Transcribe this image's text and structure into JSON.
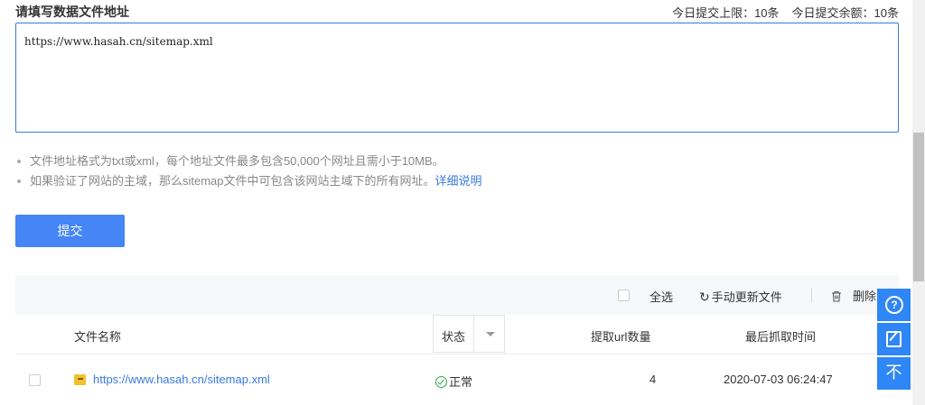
{
  "header": {
    "title": "请填写数据文件地址",
    "quota_limit": "今日提交上限：10条",
    "quota_remaining": "今日提交余额：10条"
  },
  "url_input": {
    "value": "https://www.hasah.cn/sitemap.xml"
  },
  "tips": {
    "line1": "文件地址格式为txt或xml，每个地址文件最多包含50,000个网址且需小于10MB。",
    "line2": "如果验证了网站的主域，那么sitemap文件中可包含该网站主域下的所有网址。",
    "detail_link": "详细说明"
  },
  "submit_label": "提交",
  "toolbar": {
    "select_all": "全选",
    "refresh": "手动更新文件",
    "delete": "删除"
  },
  "table": {
    "columns": {
      "filename": "文件名称",
      "status": "状态",
      "url_count": "提取url数量",
      "last_crawl": "最后抓取时间"
    },
    "rows": [
      {
        "filename": "https://www.hasah.cn/sitemap.xml",
        "status": "正常",
        "url_count": "4",
        "last_crawl": "2020-07-03 06:24:47"
      }
    ]
  },
  "float_bar": {
    "top_glyph": "不"
  }
}
